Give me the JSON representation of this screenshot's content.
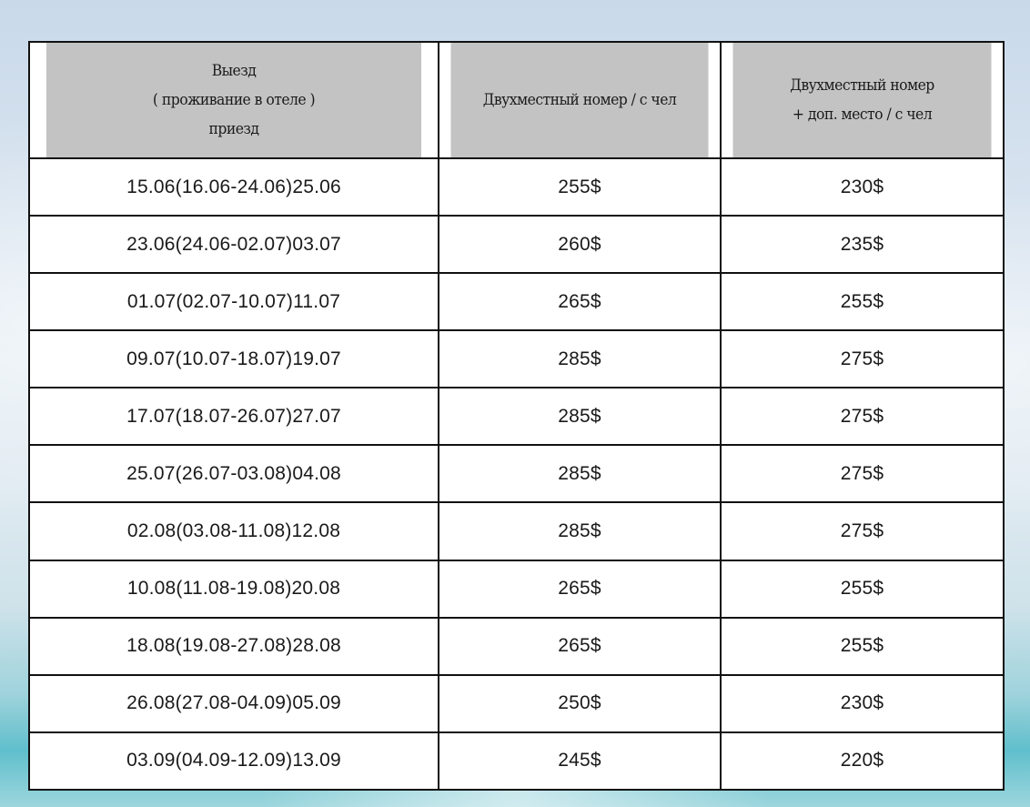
{
  "table": {
    "headers": {
      "dates": [
        "Выезд",
        "( проживание в отеле )",
        "приезд"
      ],
      "double": [
        "Двухместный номер / с чел"
      ],
      "extra": [
        "Двухместный номер",
        "+ доп. место / с чел"
      ]
    },
    "rows": [
      {
        "dates": "15.06(16.06-24.06)25.06",
        "double": "255$",
        "extra": "230$"
      },
      {
        "dates": "23.06(24.06-02.07)03.07",
        "double": "260$",
        "extra": "235$"
      },
      {
        "dates": "01.07(02.07-10.07)11.07",
        "double": "265$",
        "extra": "255$"
      },
      {
        "dates": "09.07(10.07-18.07)19.07",
        "double": "285$",
        "extra": "275$"
      },
      {
        "dates": "17.07(18.07-26.07)27.07",
        "double": "285$",
        "extra": "275$"
      },
      {
        "dates": "25.07(26.07-03.08)04.08",
        "double": "285$",
        "extra": "275$"
      },
      {
        "dates": "02.08(03.08-11.08)12.08",
        "double": "285$",
        "extra": "275$"
      },
      {
        "dates": "10.08(11.08-19.08)20.08",
        "double": "265$",
        "extra": "255$"
      },
      {
        "dates": "18.08(19.08-27.08)28.08",
        "double": "265$",
        "extra": "255$"
      },
      {
        "dates": "26.08(27.08-04.09)05.09",
        "double": "250$",
        "extra": "230$"
      },
      {
        "dates": "03.09(04.09-12.09)13.09",
        "double": "245$",
        "extra": "220$"
      }
    ]
  },
  "colors": {
    "header_bg": "#c3c3c3",
    "border": "#111111",
    "cell_bg": "#ffffff",
    "text": "#1a1a1a"
  }
}
